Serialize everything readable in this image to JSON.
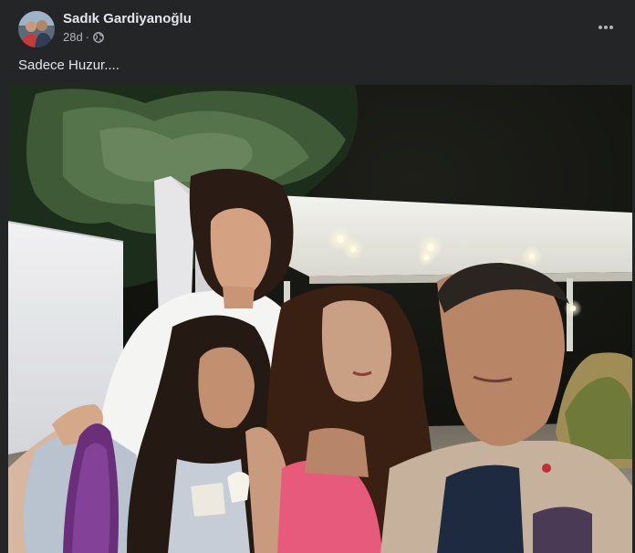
{
  "post": {
    "author": {
      "name": "Sadık Gardiyanoğlu"
    },
    "timestamp": "28d",
    "separator": "·",
    "privacy_icon": "globe-icon",
    "more_icon": "more-options-icon",
    "caption": "Sadece Huzur....",
    "photo": {
      "subject": "night-family-selfie"
    }
  },
  "colors": {
    "background": "#242526",
    "text_primary": "#e4e6eb",
    "text_secondary": "#b0b3b8"
  }
}
